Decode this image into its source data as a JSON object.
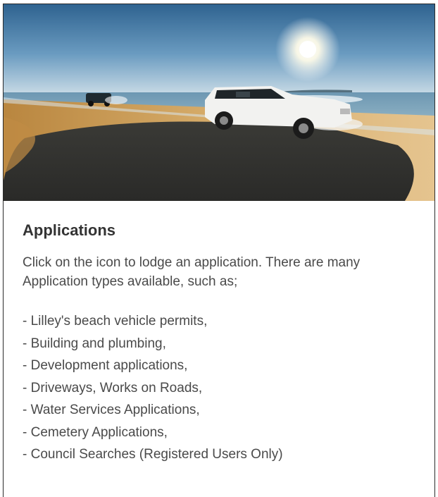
{
  "card": {
    "image_alt": "beach-vehicle-photo",
    "title": "Applications",
    "intro": "Click on the icon to lodge an application. There are many Application types available, such as;",
    "items": [
      "- Lilley's beach vehicle permits,",
      "- Building and plumbing,",
      "- Development applications,",
      "- Driveways, Works on Roads,",
      "- Water Services Applications,",
      "- Cemetery Applications,",
      "- Council Searches (Registered Users Only)"
    ]
  },
  "colors": {
    "text": "#4a4a4a",
    "heading": "#333333",
    "border": "#2b2b2b",
    "sky": "#3d6f9a",
    "sand": "#c99a52",
    "sea": "#5a8aa8"
  }
}
